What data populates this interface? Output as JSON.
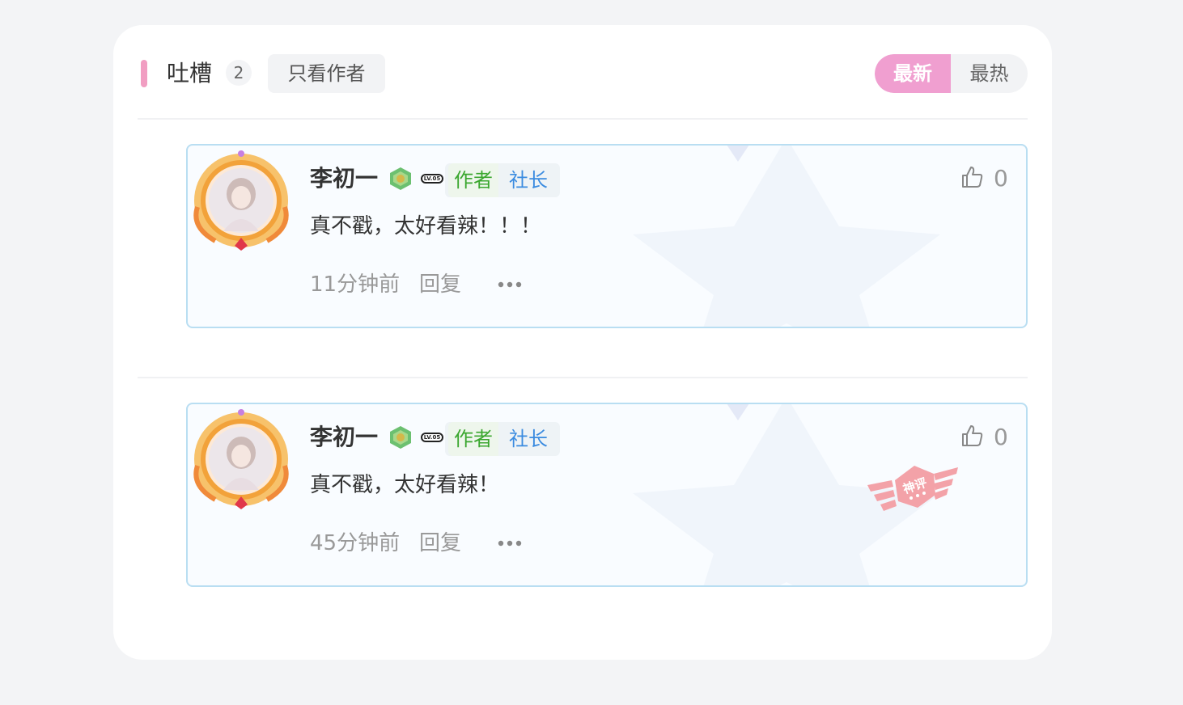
{
  "header": {
    "title": "吐槽",
    "count": "2",
    "author_filter_label": "只看作者",
    "sort": {
      "latest_label": "最新",
      "hottest_label": "最热",
      "active": "最新"
    }
  },
  "colors": {
    "accent_pink": "#f19ec2",
    "sort_active_bg": "#f09fd0",
    "author_tag": "#3ba72f",
    "chief_tag": "#3a8be0",
    "comment_border": "#b9def2"
  },
  "comments": [
    {
      "username": "李初一",
      "level_badge": "LV.05",
      "tags": {
        "author": "作者",
        "chief": "社长"
      },
      "content": "真不戳，太好看辣！！！",
      "time": "11分钟前",
      "reply_label": "回复",
      "likes": "0",
      "stamp": ""
    },
    {
      "username": "李初一",
      "level_badge": "LV.05",
      "tags": {
        "author": "作者",
        "chief": "社长"
      },
      "content": "真不戳，太好看辣！",
      "time": "45分钟前",
      "reply_label": "回复",
      "likes": "0",
      "stamp": "神评"
    }
  ]
}
